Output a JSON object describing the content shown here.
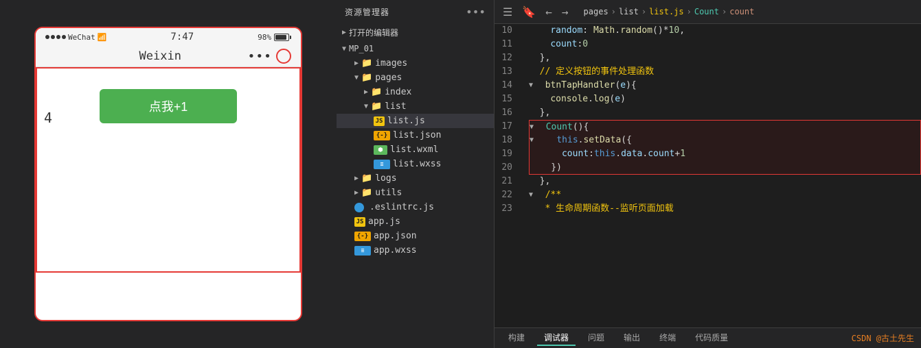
{
  "phone": {
    "status": {
      "signal_label": "WeChat",
      "wifi_icon": "📶",
      "time": "7:47",
      "battery_percent": "98%"
    },
    "title_bar": {
      "title": "Weixin",
      "dots": "•••"
    },
    "content": {
      "button_label": "点我+1",
      "count_value": "4"
    }
  },
  "explorer": {
    "title": "资源管理器",
    "dots": "•••",
    "open_editors_label": "打开的编辑器",
    "project_name": "MP_01",
    "items": [
      {
        "name": "images",
        "type": "folder",
        "level": 1,
        "collapsed": true
      },
      {
        "name": "pages",
        "type": "folder",
        "level": 1,
        "collapsed": false
      },
      {
        "name": "index",
        "type": "folder",
        "level": 2,
        "collapsed": true
      },
      {
        "name": "list",
        "type": "folder",
        "level": 2,
        "collapsed": false
      },
      {
        "name": "list.js",
        "type": "js",
        "level": 3,
        "active": true
      },
      {
        "name": "list.json",
        "type": "json",
        "level": 3
      },
      {
        "name": "list.wxml",
        "type": "wxml",
        "level": 3
      },
      {
        "name": "list.wxss",
        "type": "wxss",
        "level": 3
      },
      {
        "name": "logs",
        "type": "folder",
        "level": 1,
        "collapsed": true
      },
      {
        "name": "utils",
        "type": "folder",
        "level": 1,
        "collapsed": true
      },
      {
        "name": ".eslintrc.js",
        "type": "dotjs",
        "level": 1
      },
      {
        "name": "app.js",
        "type": "js",
        "level": 1
      },
      {
        "name": "app.json",
        "type": "json",
        "level": 1
      },
      {
        "name": "app.wxss",
        "type": "wxss",
        "level": 1
      }
    ]
  },
  "editor": {
    "breadcrumb": {
      "pages": "pages",
      "list": "list",
      "listjs": "list.js",
      "count_icon": "⊕",
      "count": "Count",
      "property": "count"
    },
    "lines": [
      {
        "num": 10,
        "content": "    random: Math.random()*10,"
      },
      {
        "num": 11,
        "content": "    count:0"
      },
      {
        "num": 12,
        "content": "  },"
      },
      {
        "num": 13,
        "content": "  // 定义按钮的事件处理函数",
        "is_comment": true
      },
      {
        "num": 14,
        "content": "  btnTapHandler(e){",
        "has_arrow": true
      },
      {
        "num": 15,
        "content": "    console.log(e)"
      },
      {
        "num": 16,
        "content": "  },"
      },
      {
        "num": 17,
        "content": "  Count(){",
        "highlighted": true,
        "has_arrow": true
      },
      {
        "num": 18,
        "content": "    this.setData({",
        "highlighted": true,
        "has_arrow": true
      },
      {
        "num": 19,
        "content": "      count:this.data.count+1",
        "highlighted": true
      },
      {
        "num": 20,
        "content": "    })",
        "highlighted": true
      },
      {
        "num": 21,
        "content": "  },"
      },
      {
        "num": 22,
        "content": "  /**",
        "has_arrow": true
      },
      {
        "num": 23,
        "content": "   * 生命周期函数--监听页面加载",
        "is_comment": true
      }
    ],
    "footer_tabs": [
      "构建",
      "调试器",
      "问题",
      "输出",
      "终端",
      "代码质量"
    ],
    "active_footer_tab": "调试器",
    "footer_right": "CSDN @古土先生"
  }
}
